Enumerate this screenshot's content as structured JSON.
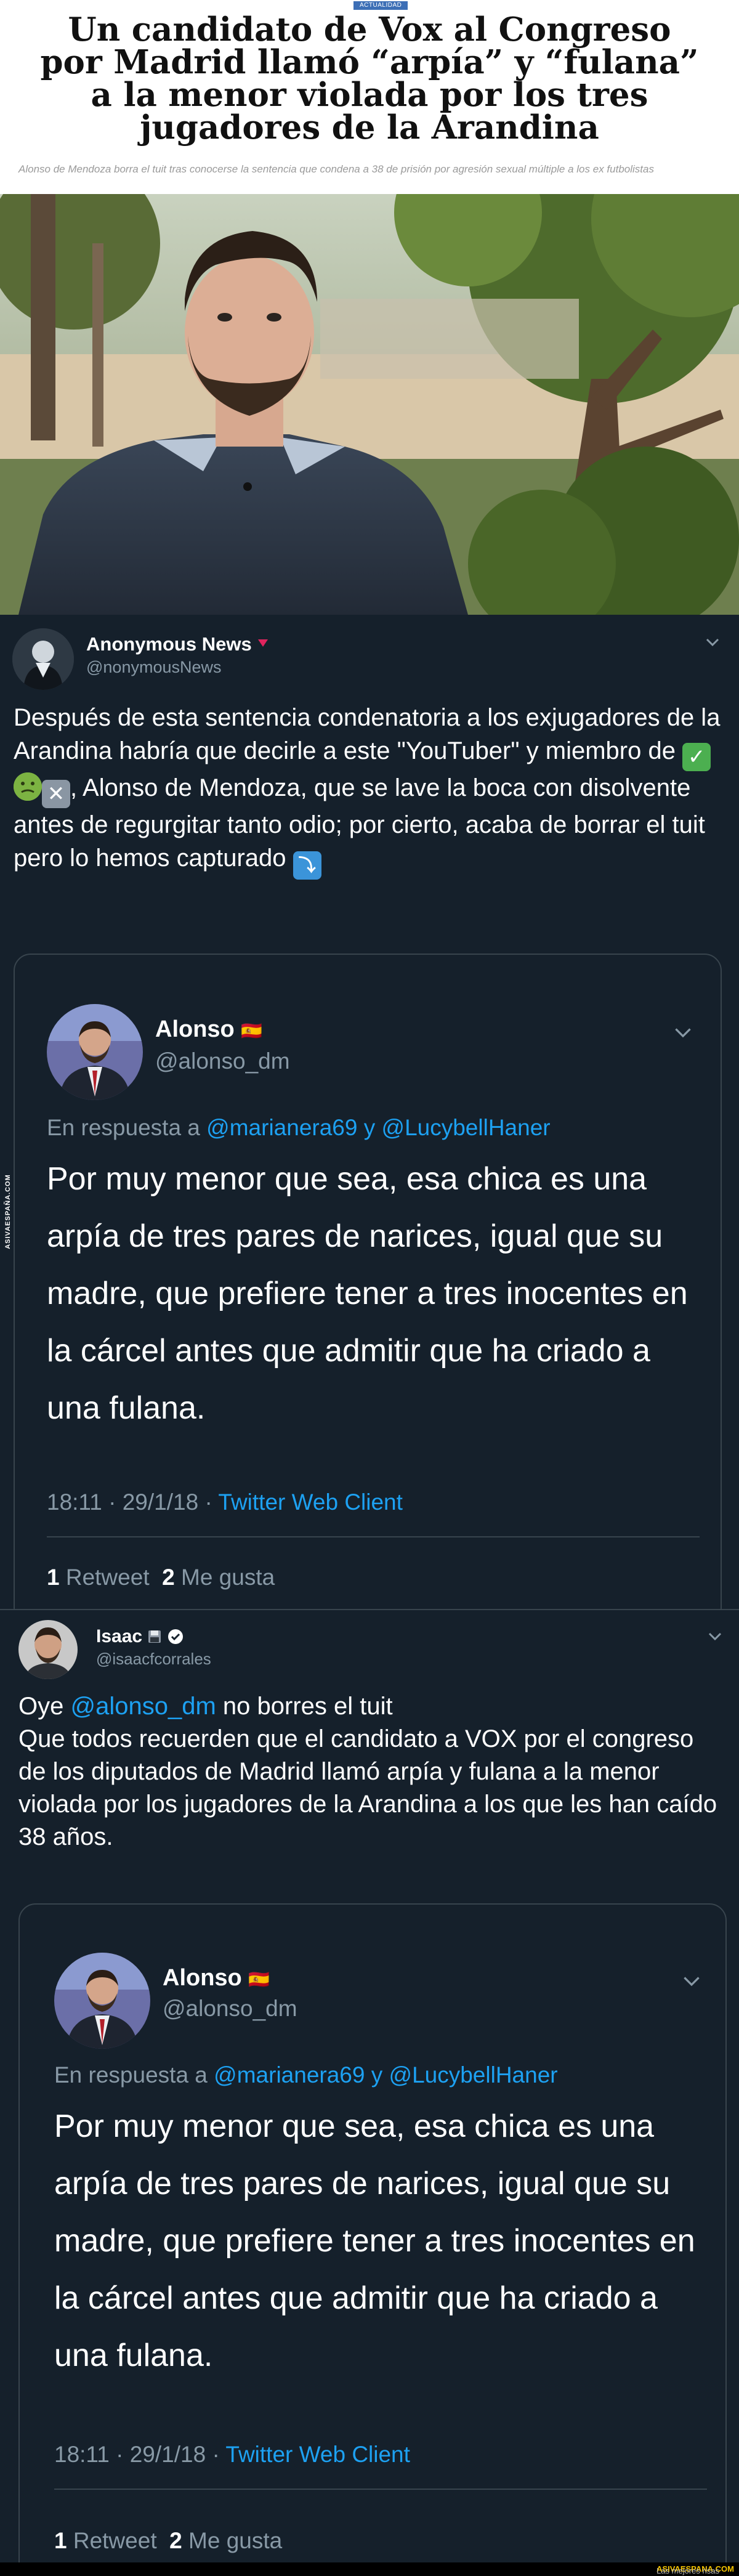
{
  "article": {
    "category": "ACTUALIDAD",
    "headline": "Un candidato de Vox al Congreso por Madrid llamó “arpía” y “fulana” a la menor violada por los tres jugadores de la Arandina",
    "subheadline": "Alonso de Mendoza borra el tuit tras conocerse la sentencia que condena a 38 de prisión por agresión sexual múltiple a los ex futbolistas"
  },
  "tweet1": {
    "name": "Anonymous News",
    "handle": "@nonymousNews",
    "text_part1": "Después de esta sentencia condenatoria a los exjugadores de la Arandina habría que decirle a este \"YouTuber\" y miembro de ",
    "text_part2": ", Alonso de Mendoza, que se lave la boca con disolvente antes de regurgitar tanto odio; por cierto, acaba de borrar el tuit pero lo hemos capturado ",
    "quote": {
      "name": "Alonso",
      "flag": "🇪🇸",
      "handle": "@alonso_dm",
      "reply_prefix": "En respuesta a",
      "reply_users": "@marianera69 y @LucybellHaner",
      "text": "Por muy menor que sea, esa chica es una arpía de tres pares de narices, igual que su madre, que prefiere tener a tres inocentes en la cárcel antes que admitir que ha criado a una fulana.",
      "timestamp": "18:11 · 29/1/18 · ",
      "client": "Twitter Web Client",
      "retweets_count": "1",
      "retweets_label": "Retweet",
      "likes_count": "2",
      "likes_label": "Me gusta"
    }
  },
  "tweet2": {
    "name": "Isaac",
    "handle": "@isaacfcorrales",
    "line1_prefix": "Oye ",
    "line1_mention": "@alonso_dm",
    "line1_suffix": " no borres el tuit",
    "text": "Que todos recuerden que el candidato a VOX por el congreso de los diputados de Madrid llamó arpía y fulana a la menor violada por los jugadores de la Arandina a los que les han caído 38 años.",
    "quote": {
      "name": "Alonso",
      "flag": "🇪🇸",
      "handle": "@alonso_dm",
      "reply_prefix": "En respuesta a",
      "reply_users": "@marianera69 y @LucybellHaner",
      "text": "Por muy menor que sea, esa chica es una arpía de tres pares de narices, igual que su madre, que prefiere tener a tres inocentes en la cárcel antes que admitir que ha criado a una fulana.",
      "timestamp": "18:11 · 29/1/18 · ",
      "client": "Twitter Web Client",
      "retweets_count": "1",
      "retweets_label": "Retweet",
      "likes_count": "2",
      "likes_label": "Me gusta"
    }
  },
  "watermark": "ASIVAESPAÑA.COM",
  "footer": {
    "prefix": "Las mejores risas en ",
    "brand": "ASIVAESPANA.COM"
  },
  "colors": {
    "tweet_bg": "#15202b",
    "link": "#1da1f2",
    "muted": "#8899a6",
    "border": "#38444d",
    "category_tag": "#3d6fb6"
  }
}
